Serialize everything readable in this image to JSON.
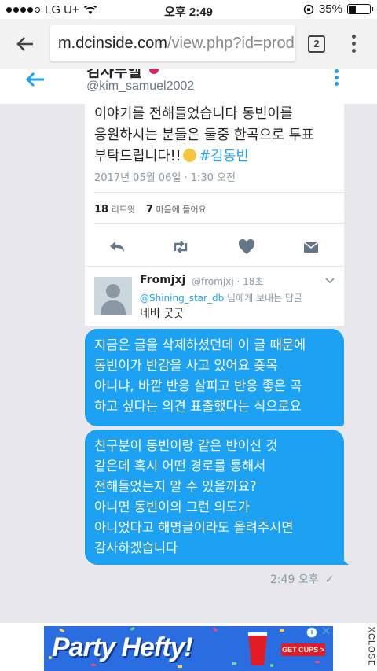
{
  "status_bar": {
    "carrier": "LG U+",
    "time": "오후 2:49",
    "battery_percent": "35%",
    "battery_level": 0.35
  },
  "browser": {
    "url_host": "m.dcinside.com",
    "url_path": "/view.php?id=produ",
    "tab_count": "2"
  },
  "tweet_header": {
    "display_name": "김사무엘",
    "handle": "@kim_samuel2002"
  },
  "tweet": {
    "text_lines": [
      "이야기를 전해들었습니다 동빈이를",
      "응원하시는 분들은 둘중 한곡으로 투표",
      "부탁드립니다!!"
    ],
    "hashtag": "#김동빈",
    "date": "2017년 05월 06일 · 1:30 오전",
    "retweets_count": "18",
    "retweets_label": "리트윗",
    "likes_count": "7",
    "likes_label": "마음에 들어요"
  },
  "reply": {
    "name": "Fromjxj",
    "meta": "@fromjxj · 18초",
    "reply_to_handle": "@Shining_star_db",
    "reply_to_suffix": " 님에게 보내는 답글",
    "text": "네버 굿굿"
  },
  "messages": [
    {
      "lines": [
        "지금은 글을 삭제하셨던데 이 글 때문에",
        "동빈이가 반감을 사고 있어요 죶목",
        "아니냐, 바깥 반응 살피고 반응 좋은 곡",
        "하고 싶다는 의견 표출했다는 식으로요"
      ]
    },
    {
      "lines": [
        "친구분이 동빈이랑 같은 반이신 것",
        "같은데 혹시 어떤 경로를 통해서",
        "전해들었는지 알 수 있을까요?",
        "아니면 동빈이의 그런 의도가",
        "아니었다고 해명글이라도 올려주시면",
        "감사하겠습니다"
      ]
    }
  ],
  "message_meta": {
    "time": "2:49 오후",
    "check": "✓"
  },
  "ad": {
    "title": "Party Hefty!",
    "cta": "GET CUPS >",
    "info": "i",
    "xclose": "XCLOSE"
  },
  "colors": {
    "twitter_blue": "#1da1f2",
    "ad_blue": "#2a6de0",
    "ad_red": "#e21b25"
  }
}
